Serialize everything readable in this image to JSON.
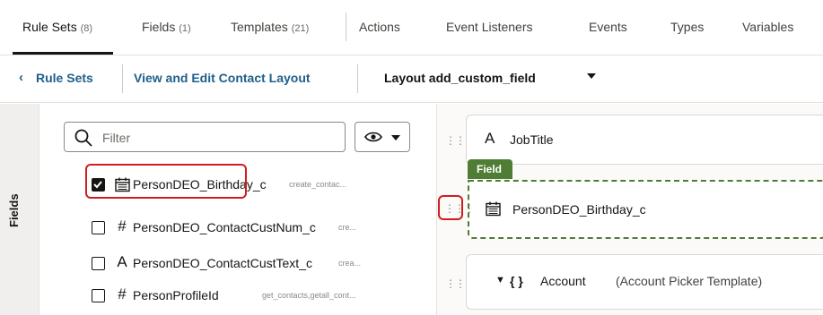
{
  "tabs": [
    {
      "label": "Rule Sets",
      "count": "(8)",
      "active": true
    },
    {
      "label": "Fields",
      "count": "(1)",
      "active": false
    },
    {
      "label": "Templates",
      "count": "(21)",
      "active": false
    },
    {
      "label": "Actions",
      "count": "",
      "active": false
    },
    {
      "label": "Event Listeners",
      "count": "",
      "active": false
    },
    {
      "label": "Events",
      "count": "",
      "active": false
    },
    {
      "label": "Types",
      "count": "",
      "active": false
    },
    {
      "label": "Variables",
      "count": "",
      "active": false
    }
  ],
  "breadcrumb": {
    "back_label": "Rule Sets",
    "current": "View and Edit Contact Layout",
    "layout": "Layout add_custom_field"
  },
  "side_panel": {
    "label": "Fields"
  },
  "filter": {
    "placeholder": "Filter",
    "value": ""
  },
  "fields": [
    {
      "name": "PersonDEO_Birthday_c",
      "type_icon": "calendar-icon",
      "type_glyph": "📅",
      "meta": "create_contac...",
      "checked": true
    },
    {
      "name": "PersonDEO_ContactCustNum_c",
      "type_icon": "number-icon",
      "type_glyph": "#",
      "meta": "cre...",
      "checked": false
    },
    {
      "name": "PersonDEO_ContactCustText_c",
      "type_icon": "text-icon",
      "type_glyph": "A",
      "meta": "crea...",
      "checked": false
    },
    {
      "name": "PersonProfileId",
      "type_icon": "number-icon",
      "type_glyph": "#",
      "meta": "get_contacts,getall_cont...",
      "checked": false
    }
  ],
  "canvas": {
    "jobtitle": {
      "icon": "text-icon",
      "glyph": "A",
      "label": "JobTitle"
    },
    "field_chip": "Field",
    "birthday": {
      "icon": "calendar-icon",
      "label": "PersonDEO_Birthday_c"
    },
    "account": {
      "label": "Account",
      "template": "(Account Picker Template)"
    }
  },
  "colors": {
    "link": "#1f5f8b",
    "highlight": "#d01d1d",
    "field_green": "#4f7d34"
  }
}
